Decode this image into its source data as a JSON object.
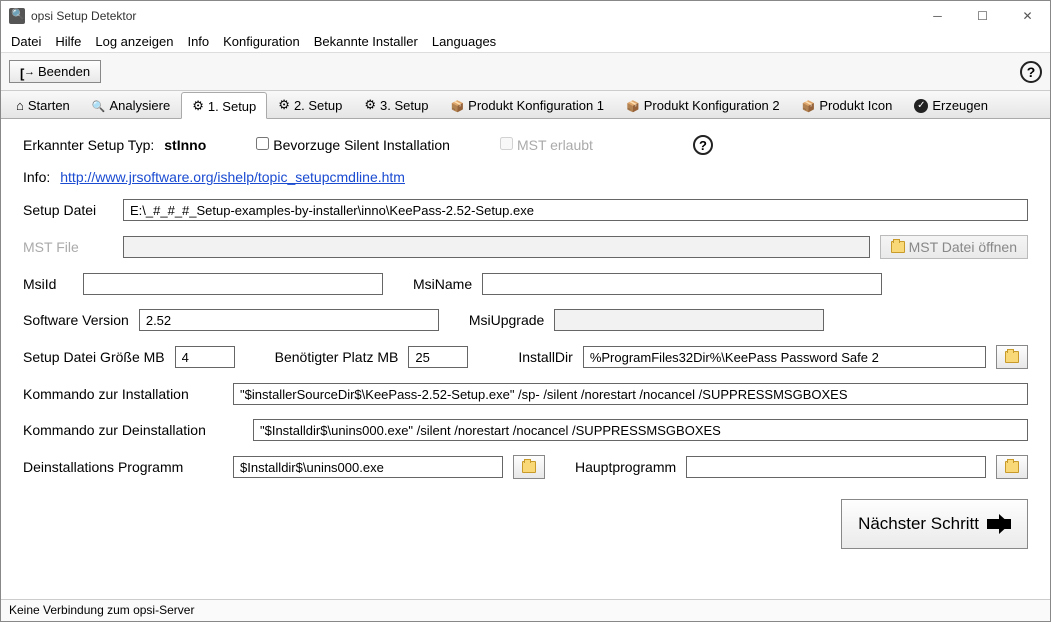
{
  "window": {
    "title": "opsi Setup Detektor"
  },
  "menu": {
    "datei": "Datei",
    "hilfe": "Hilfe",
    "log": "Log anzeigen",
    "info": "Info",
    "konfig": "Konfiguration",
    "bekannte": "Bekannte Installer",
    "lang": "Languages"
  },
  "toolbar": {
    "beenden": "Beenden"
  },
  "tabs": {
    "starten": "Starten",
    "analysiere": "Analysiere",
    "setup1": "1. Setup",
    "setup2": "2. Setup",
    "setup3": "3. Setup",
    "konfig1": "Produkt Konfiguration 1",
    "konfig2": "Produkt Konfiguration 2",
    "icon": "Produkt Icon",
    "erzeugen": "Erzeugen"
  },
  "form": {
    "erkannter_label": "Erkannter Setup Typ:",
    "erkannter_value": "stInno",
    "bevorzuge": "Bevorzuge Silent Installation",
    "mst_erlaubt": "MST erlaubt",
    "info_label": "Info:",
    "info_link": "http://www.jrsoftware.org/ishelp/topic_setupcmdline.htm",
    "setup_datei_label": "Setup Datei",
    "setup_datei_value": "E:\\_#_#_#_Setup-examples-by-installer\\inno\\KeePass-2.52-Setup.exe",
    "mst_file_label": "MST File",
    "mst_file_value": "",
    "mst_open": "MST Datei öffnen",
    "msiid_label": "MsiId",
    "msiid_value": "",
    "msiname_label": "MsiName",
    "msiname_value": "",
    "sw_version_label": "Software Version",
    "sw_version_value": "2.52",
    "msiupgrade_label": "MsiUpgrade",
    "msiupgrade_value": "",
    "setup_size_label": "Setup Datei Größe MB",
    "setup_size_value": "4",
    "needed_label": "Benötigter Platz MB",
    "needed_value": "25",
    "installdir_label": "InstallDir",
    "installdir_value": "%ProgramFiles32Dir%\\KeePass Password Safe 2",
    "kmd_install_label": "Kommando zur Installation",
    "kmd_install_value": "\"$installerSourceDir$\\KeePass-2.52-Setup.exe\" /sp- /silent /norestart /nocancel /SUPPRESSMSGBOXES",
    "kmd_deinstall_label": "Kommando zur Deinstallation",
    "kmd_deinstall_value": "\"$Installdir$\\unins000.exe\" /silent /norestart /nocancel /SUPPRESSMSGBOXES",
    "deinstall_prog_label": "Deinstallations Programm",
    "deinstall_prog_value": "$Installdir$\\unins000.exe",
    "haupt_label": "Hauptprogramm",
    "haupt_value": "",
    "next": "Nächster Schritt"
  },
  "status": "Keine Verbindung zum opsi-Server"
}
